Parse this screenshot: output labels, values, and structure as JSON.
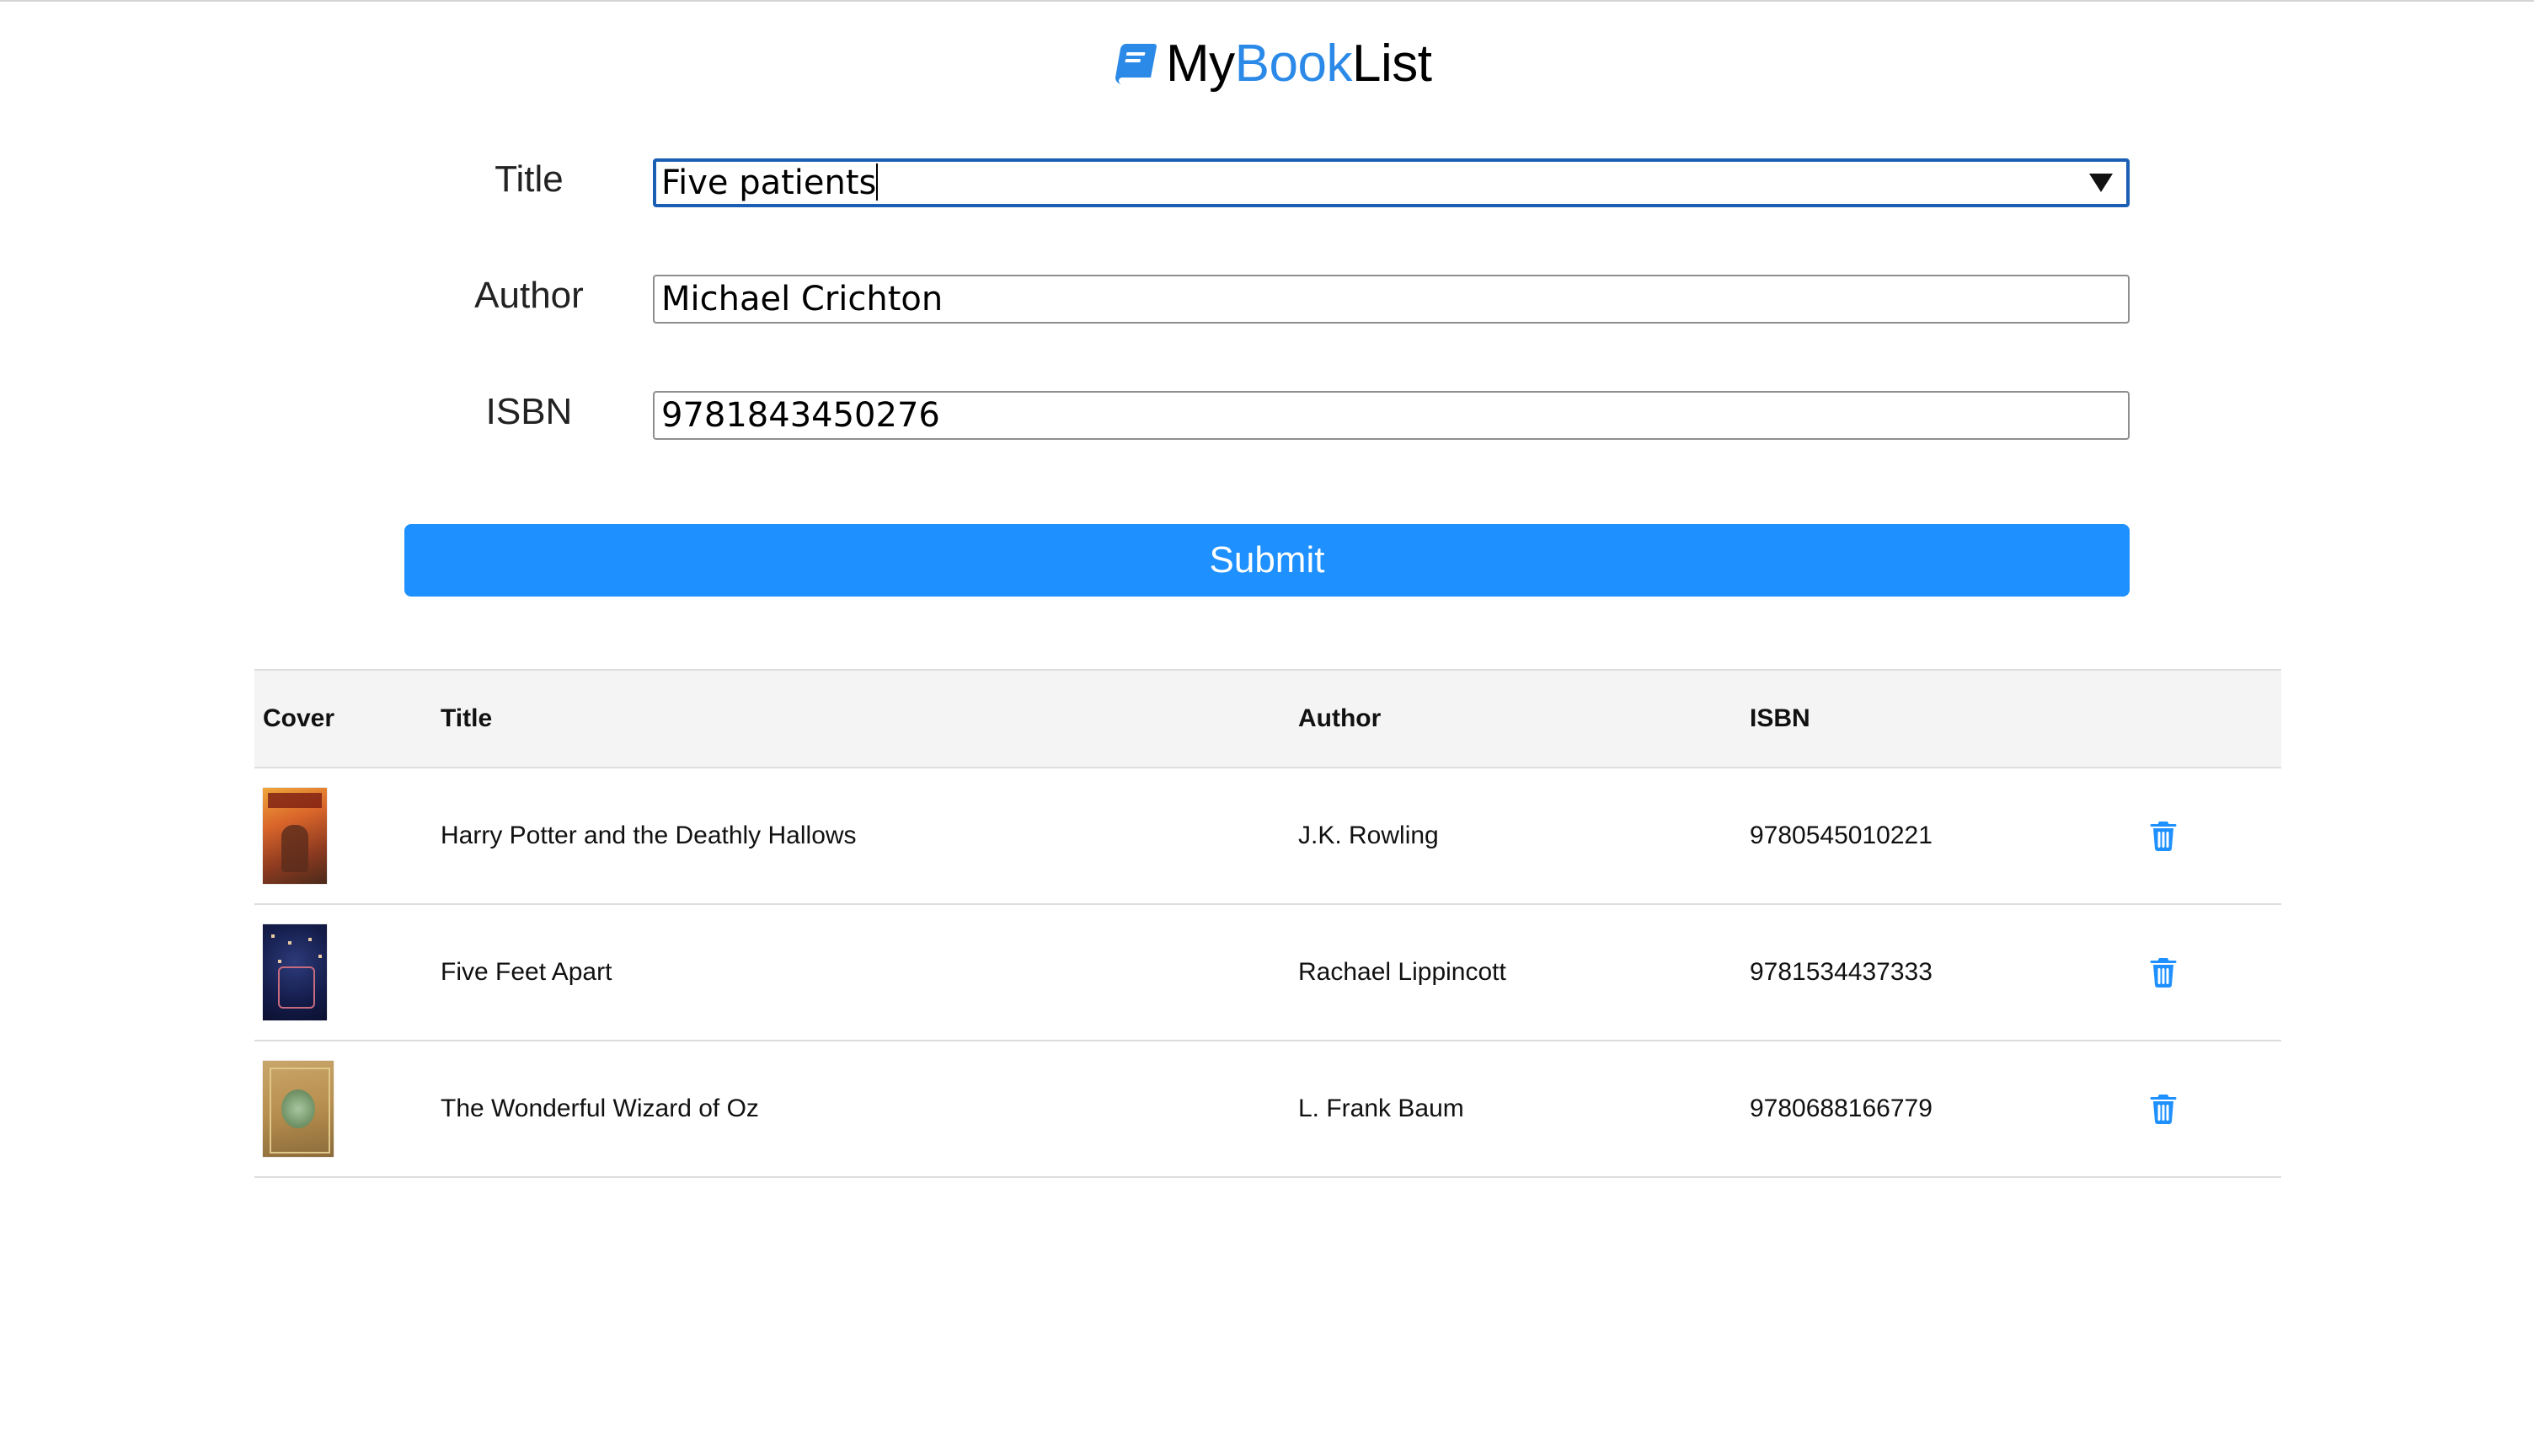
{
  "app": {
    "logo_part1": "My",
    "logo_part2": "Book",
    "logo_part3": "List",
    "logo_icon": "book-icon",
    "accent_color": "#2b8ae8"
  },
  "form": {
    "title_label": "Title",
    "title_value": "Five patients",
    "author_label": "Author",
    "author_value": "Michael Crichton",
    "isbn_label": "ISBN",
    "isbn_value": "9781843450276",
    "submit_label": "Submit",
    "submit_color": "#1e90ff"
  },
  "table": {
    "columns": [
      "Cover",
      "Title",
      "Author",
      "ISBN",
      ""
    ],
    "rows": [
      {
        "cover": "harry-potter-cover",
        "title": "Harry Potter and the Deathly Hallows",
        "author": "J.K. Rowling",
        "isbn": "9780545010221",
        "action_icon": "trash-icon"
      },
      {
        "cover": "five-feet-apart-cover",
        "title": "Five Feet Apart",
        "author": "Rachael Lippincott",
        "isbn": "9781534437333",
        "action_icon": "trash-icon"
      },
      {
        "cover": "wizard-of-oz-cover",
        "title": "The Wonderful Wizard of Oz",
        "author": "L. Frank Baum",
        "isbn": "9780688166779",
        "action_icon": "trash-icon"
      }
    ]
  }
}
